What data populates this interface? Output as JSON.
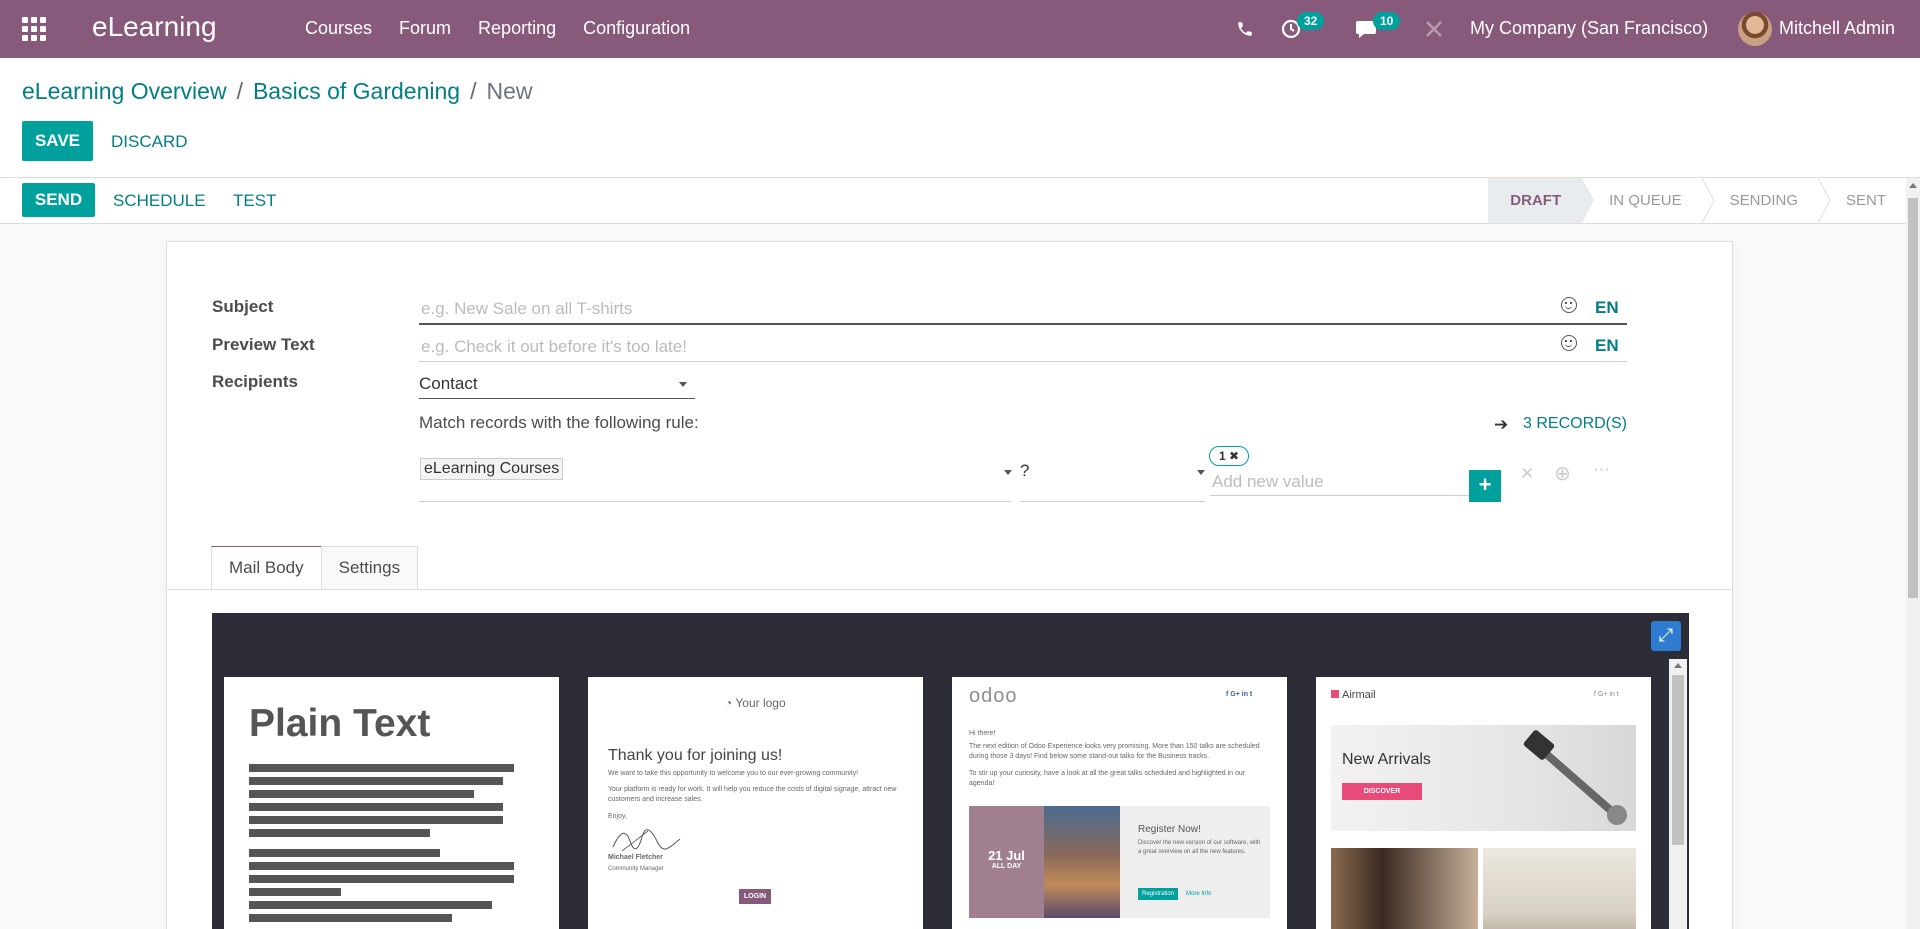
{
  "navbar": {
    "app_name": "eLearning",
    "menu": [
      "Courses",
      "Forum",
      "Reporting",
      "Configuration"
    ],
    "activity_count": "32",
    "message_count": "10",
    "company": "My Company (San Francisco)",
    "user": "Mitchell Admin"
  },
  "breadcrumb": {
    "root": "eLearning Overview",
    "parent": "Basics of Gardening",
    "current": "New"
  },
  "actions": {
    "save": "SAVE",
    "discard": "DISCARD"
  },
  "header": {
    "send": "SEND",
    "schedule": "SCHEDULE",
    "test": "TEST",
    "stages": [
      "DRAFT",
      "IN QUEUE",
      "SENDING",
      "SENT"
    ],
    "active_stage": "DRAFT"
  },
  "form": {
    "subject_label": "Subject",
    "subject_placeholder": "e.g. New Sale on all T-shirts",
    "preview_label": "Preview Text",
    "preview_placeholder": "e.g. Check it out before it's too late!",
    "lang": "EN",
    "recipients_label": "Recipients",
    "recipients_value": "Contact",
    "rule_text": "Match records with the following rule:",
    "records": "3 RECORD(S)",
    "rule_field": "eLearning Courses",
    "rule_operator": "?",
    "rule_tag": "1",
    "add_value_placeholder": "Add new value"
  },
  "tabs": [
    "Mail Body",
    "Settings"
  ],
  "templates": {
    "plain_text": "Plain Text",
    "welcome": {
      "logo": "Your logo",
      "heading": "Thank you for joining us!",
      "line1": "We want to take this opportunity to welcome you to our ever-growing community!",
      "line2": "Your platform is ready for work. It will help you reduce the costs of digital signage, attract new customers and increase sales.",
      "enjoy": "Enjoy,",
      "signer": "Michael Fletcher",
      "signer_role": "Community Manager",
      "button": "LOGIN"
    },
    "event": {
      "brand": "odoo",
      "hi": "Hi there!",
      "body1": "The next edition of Odoo Experience looks very promising. More than 150 talks are scheduled during those 3 days! Find below some stand-out talks for the Business tracks.",
      "body2": "To stir up your curiosity, have a look at all the great talks scheduled and highlighted in our agenda!",
      "date": "21 Jul",
      "date_sub": "ALL DAY",
      "register": "Register Now!",
      "register_text": "Discover the new version of our software, with a great overview on all the new features.",
      "btn_registration": "Registration",
      "btn_more": "More Info"
    },
    "airmail": {
      "brand": "Airmail",
      "headline": "New Arrivals",
      "cta": "DISCOVER"
    }
  },
  "colors": {
    "brand": "#875a7b",
    "primary": "#00a09d",
    "link": "#017e84"
  }
}
